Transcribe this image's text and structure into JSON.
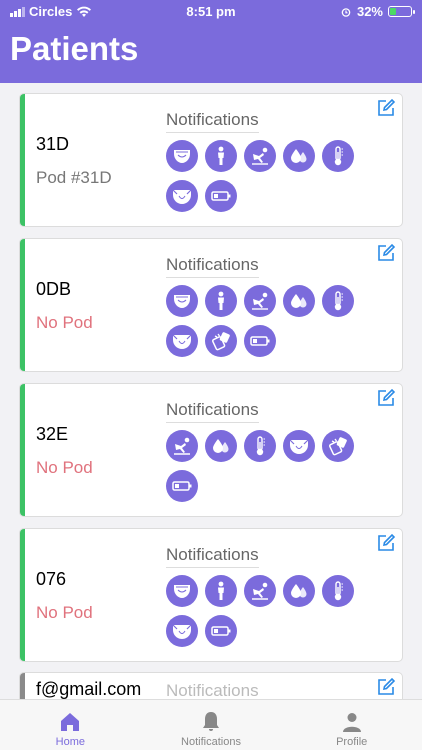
{
  "status_bar": {
    "carrier": "Circles",
    "time": "8:51 pm",
    "battery": "32%",
    "battery_level": 0.32
  },
  "header": {
    "title": "Patients"
  },
  "colors": {
    "accent": "#7b6bdc",
    "active_stripe": "#3cc265",
    "inactive_stripe": "#8a8a8a",
    "no_pod": "#e0727d",
    "pod": "#777777"
  },
  "notifications_label": "Notifications",
  "patients": [
    {
      "id": "31D",
      "pod": "Pod #31D",
      "has_pod": true,
      "icons": [
        "diaper-icon",
        "standing-person-icon",
        "fall-icon",
        "water-drop-icon",
        "thermometer-icon",
        "diaper-open-icon",
        "battery-icon"
      ]
    },
    {
      "id": "0DB",
      "pod": "No Pod",
      "has_pod": false,
      "icons": [
        "diaper-icon",
        "standing-person-icon",
        "fall-icon",
        "water-drop-icon",
        "thermometer-icon",
        "diaper-open-icon",
        "pod-detached-icon",
        "battery-icon"
      ]
    },
    {
      "id": "32E",
      "pod": "No Pod",
      "has_pod": false,
      "icons": [
        "fall-icon",
        "water-drop-icon",
        "thermometer-icon",
        "diaper-open-icon",
        "pod-detached-icon",
        "battery-icon"
      ]
    },
    {
      "id": "076",
      "pod": "No Pod",
      "has_pod": false,
      "icons": [
        "diaper-icon",
        "standing-person-icon",
        "fall-icon",
        "water-drop-icon",
        "thermometer-icon",
        "diaper-open-icon",
        "battery-icon"
      ]
    }
  ],
  "partial_patient": {
    "id": "f@gmail.com",
    "notifications_label": "Notifications"
  },
  "tabbar": {
    "home": "Home",
    "notifications": "Notifications",
    "profile": "Profile"
  }
}
